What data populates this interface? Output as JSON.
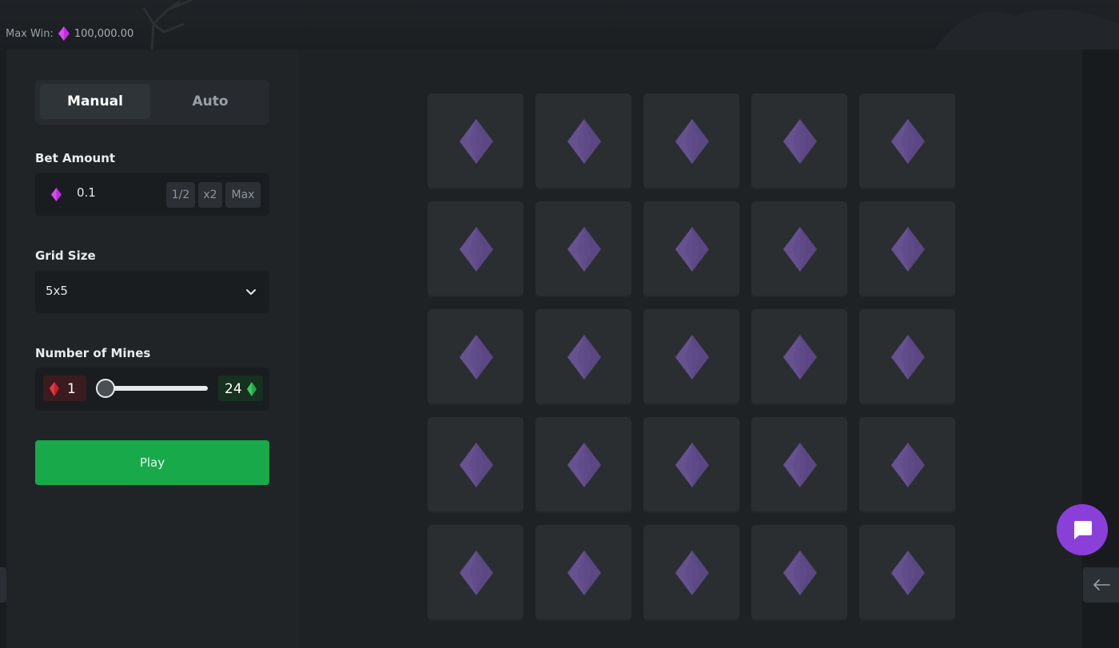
{
  "header": {
    "max_win_label": "Max Win:",
    "max_win_value": "100,000.00"
  },
  "mode_tabs": [
    {
      "label": "Manual",
      "active": true
    },
    {
      "label": "Auto",
      "active": false
    }
  ],
  "bet": {
    "label": "Bet Amount",
    "value": "0.1",
    "half_label": "1/2",
    "double_label": "x2",
    "max_label": "Max"
  },
  "grid_size": {
    "label": "Grid Size",
    "selected": "5x5"
  },
  "mines": {
    "label": "Number of Mines",
    "mine_count": "1",
    "gem_count": "24",
    "slider": {
      "min": 1,
      "max": 24,
      "value": 1
    }
  },
  "play": {
    "label": "Play"
  },
  "board": {
    "rows": 5,
    "cols": 5,
    "tile_icon": "gem-icon"
  },
  "colors": {
    "gem_magenta": "#c02ce0",
    "gem_tile_purple": "#5d4a86",
    "mine_red": "#c8202a",
    "gem_green": "#2aa74a",
    "play_green": "#18a94b",
    "chat_purple": "#8b3fd9"
  }
}
